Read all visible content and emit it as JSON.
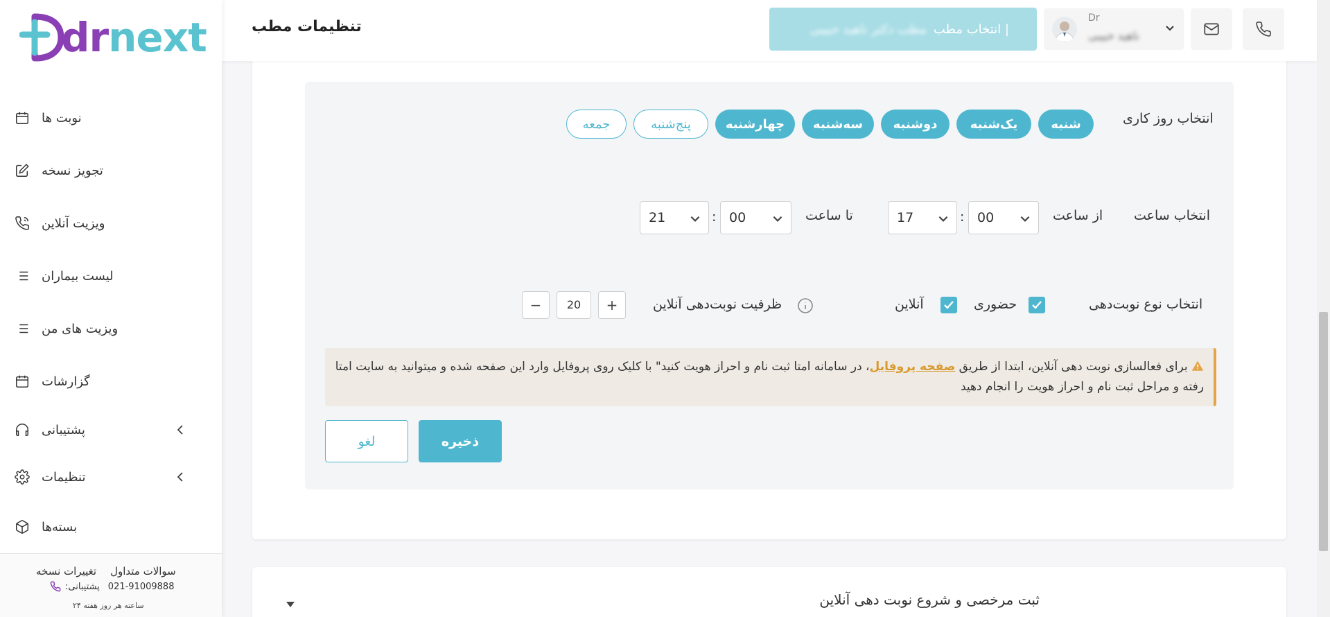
{
  "brand": {
    "name_dr": "dr",
    "name_next": "next",
    "primary_color": "#4eb7cf",
    "purple": "#8a3fb5",
    "teal": "#5bc3d0"
  },
  "header": {
    "title": "تنظیمات مطب",
    "office_button_label": "انتخاب مطب |",
    "office_button_sub": "مطب دکتر ناهید حبیبی",
    "user_prefix": "Dr",
    "user_name": "ناهید حبیبی"
  },
  "sidebar": {
    "items": [
      {
        "label": "نوبت ها",
        "icon": "calendar-icon"
      },
      {
        "label": "تجویز نسخه",
        "icon": "edit-icon"
      },
      {
        "label": "ویزیت آنلاین",
        "icon": "phone-call-icon"
      },
      {
        "label": "لیست بیماران",
        "icon": "list-icon"
      },
      {
        "label": "ویزیت های من",
        "icon": "list-icon"
      },
      {
        "label": "گزارشات",
        "icon": "calendar-icon"
      },
      {
        "label": "پشتیبانی",
        "icon": "headphones-icon",
        "expandable": true
      },
      {
        "label": "تنظیمات",
        "icon": "gear-icon",
        "expandable": true
      },
      {
        "label": "بسته‌ها",
        "icon": "package-icon"
      }
    ],
    "footer": {
      "faq": "سوالات متداول",
      "changelog": "تغییرات نسخه",
      "support_label": ":پشتیبانی",
      "support_phone": "021-91009888",
      "hours": "۲۴ ساعته هر روز هفته"
    }
  },
  "schedule": {
    "workday_label": "انتخاب روز کاری",
    "days": [
      {
        "label": "شنبه",
        "selected": true
      },
      {
        "label": "یک‌شنبه",
        "selected": true
      },
      {
        "label": "دوشنبه",
        "selected": true
      },
      {
        "label": "سه‌شنبه",
        "selected": true
      },
      {
        "label": "چهارشنبه",
        "selected": true
      },
      {
        "label": "پنج‌شنبه",
        "selected": false
      },
      {
        "label": "جمعه",
        "selected": false
      }
    ],
    "time_label": "انتخاب ساعت",
    "from_label": "از ساعت",
    "to_label": "تا ساعت",
    "from_minute": "00",
    "from_hour": "17",
    "to_minute": "00",
    "to_hour": "21",
    "colon": ":",
    "type_label": "انتخاب نوع نوبت‌دهی",
    "in_person_label": "حضوری",
    "in_person_checked": true,
    "online_label": "آنلاین",
    "online_checked": true,
    "capacity_label": "ظرفیت نوبت‌دهی آنلاین",
    "capacity_value": "20",
    "plus": "+",
    "minus": "−"
  },
  "alert": {
    "part1": "برای فعالسازی نوبت دهی آنلاین، ابتدا از طریق ",
    "link": "صفحه پروفایل",
    "part2": "، در سامانه امتا ثبت نام و احراز هویت کنید\" با کلیک روی پروفایل وارد این صفحه شده و میتوانید به سایت امتا رفته و مراحل ثبت نام و احراز هویت را انجام دهید"
  },
  "actions": {
    "save": "ذخیره",
    "cancel": "لغو"
  },
  "section2": {
    "title": "ثبت مرخصی و شروع نوبت دهی آنلاین"
  }
}
